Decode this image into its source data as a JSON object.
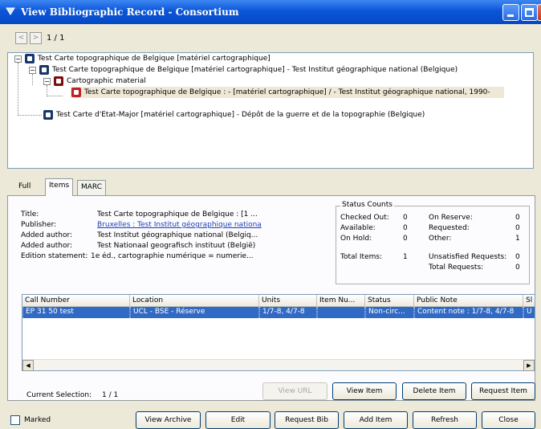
{
  "window": {
    "title": "View Bibliographic Record - Consortium"
  },
  "nav": {
    "prev_label": "<",
    "next_label": ">",
    "position": "1 / 1"
  },
  "tree": {
    "items": [
      {
        "label": "Test Carte topographique de Belgique [matériel cartographique]"
      },
      {
        "label": "Test Carte topographique de Belgique [matériel cartographique] - Test Institut géographique national (Belgique)"
      },
      {
        "label": "Cartographic material"
      },
      {
        "label": "Test Carte topographique de Belgique : - [matériel cartographique] / - Test Institut géographique national, 1990-"
      },
      {
        "label": "Test Carte d'Etat-Major [matériel cartographique] - Dépôt de la guerre et de la topographie (Belgique)"
      }
    ]
  },
  "tabs": [
    {
      "label": "Full"
    },
    {
      "label": "Items"
    },
    {
      "label": "MARC"
    }
  ],
  "details": {
    "title_label": "Title:",
    "title_value": "Test Carte topographique de Belgique : [1 ...",
    "publisher_label": "Publisher:",
    "publisher_value": "Bruxelles : Test Institut géographique nationa",
    "author1_label": "Added author:",
    "author1_value": "Test Institut géographique national (Belgiq...",
    "author2_label": "Added author:",
    "author2_value": "Test Nationaal geografisch instituut (België)",
    "edition_label": "Edition statement:",
    "edition_value": "1e éd., cartographie numérique = numerie..."
  },
  "status": {
    "legend": "Status Counts",
    "checked_out_label": "Checked Out:",
    "checked_out": "0",
    "available_label": "Available:",
    "available": "0",
    "on_hold_label": "On Hold:",
    "on_hold": "0",
    "total_items_label": "Total Items:",
    "total_items": "1",
    "on_reserve_label": "On Reserve:",
    "on_reserve": "0",
    "requested_label": "Requested:",
    "requested": "0",
    "other_label": "Other:",
    "other": "1",
    "unsatisfied_label": "Unsatisfied Requests:",
    "unsatisfied": "0",
    "total_requests_label": "Total Requests:",
    "total_requests": "0"
  },
  "grid": {
    "columns": [
      "Call Number",
      "Location",
      "Units",
      "Item Nu...",
      "Status",
      "Public Note",
      "Sl"
    ],
    "rows": [
      [
        "EP 31 50 test",
        "UCL - BSE - Réserve",
        "1/7-8, 4/7-8",
        "",
        "Non-circ...",
        "Content note : 1/7-8, 4/7-8",
        "U"
      ]
    ]
  },
  "selection": {
    "label": "Current Selection:",
    "value": "1 / 1"
  },
  "actions": {
    "view_url": "View URL",
    "view_item": "View Item",
    "delete_item": "Delete Item",
    "request_item": "Request Item",
    "view_archive": "View Archive",
    "edit": "Edit",
    "request_bib": "Request Bib",
    "add_item": "Add Item",
    "refresh": "Refresh",
    "close": "Close"
  },
  "footer": {
    "marked_label": "Marked"
  },
  "colors": {
    "titlebar": "#0a56d8",
    "selection": "#316ac5",
    "link": "#1b3fb4",
    "record_red": "#c02020"
  }
}
